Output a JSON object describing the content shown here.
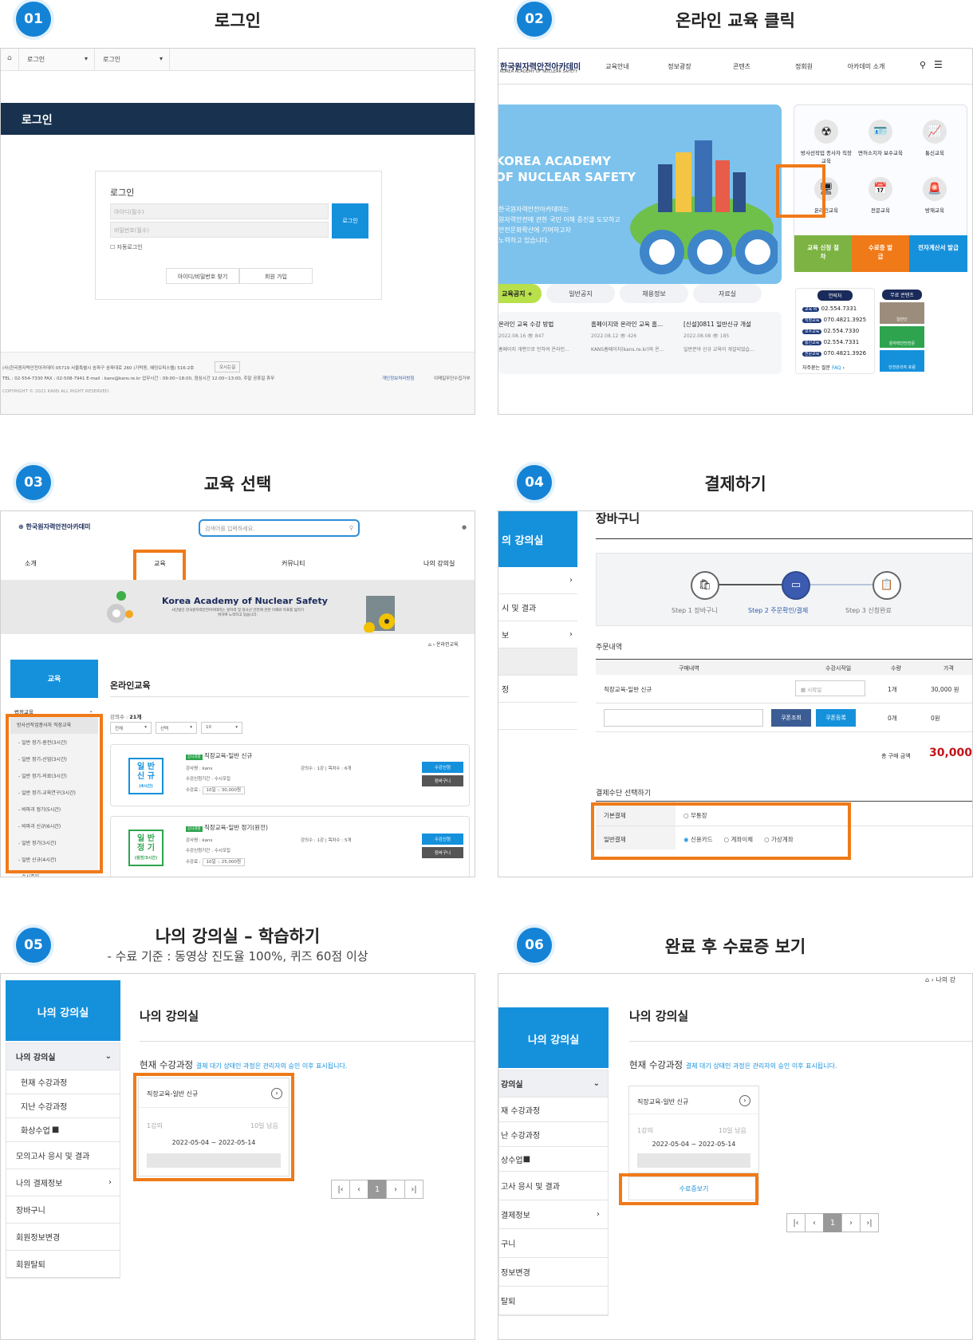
{
  "steps": [
    {
      "num": "01",
      "title": "로그인"
    },
    {
      "num": "02",
      "title": "온라인 교육 클릭"
    },
    {
      "num": "03",
      "title": "교육 선택"
    },
    {
      "num": "04",
      "title": "결제하기"
    },
    {
      "num": "05",
      "title": "나의 강의실 – 학습하기",
      "subtitle": "- 수료 기준 : 동영상 진도율 100%, 퀴즈 60점 이상"
    },
    {
      "num": "06",
      "title": "완료 후 수료증 보기"
    }
  ],
  "p1": {
    "crumb1": "로그인",
    "crumb2": "로그인",
    "banner": "로그인",
    "box_title": "로그인",
    "id_ph": "아이디(필수)",
    "pw_ph": "비밀번호(필수)",
    "login_btn": "로그인",
    "auto": "자동로그인",
    "find": "아이디/비밀번호 찾기",
    "join": "회원 가입",
    "footer1": "(사)한국원자력안전아카데미   05719 서울특별시 송파구 송파대로 260 (가락동, 혜덩오피스텔) 516-2호",
    "footer_btn": "오시는길",
    "footer2": "TEL : 02-554-7330   FAX : 02-508-7941   E-mail : kans@kans.re.kr   업무시간 : 09:00~18:00, 점심시간 12:00~13:00, 주말 공휴일 휴무",
    "privacy": "개인정보처리방침",
    "email_policy": "이메일무단수집거부",
    "copy": "COPYRIGHT © 2021 KANS ALL RIGHT RESERVED."
  },
  "p2": {
    "logo": "한국원자력안전아카데미",
    "logo_sub": "KOREA ACADEMY OF NUCLEAR SAFETY",
    "nav": [
      "교육안내",
      "정보광장",
      "콘텐츠",
      "정회원",
      "아카데미 소개"
    ],
    "hero1": "KOREA ACADEMY",
    "hero2": "OF NUCLEAR SAFETY",
    "hero_desc": [
      "한국원자력안전아카데미는",
      "원자력안전에 관한 국민 이해 증진을 도모하고",
      "안전문화확산에 기여하고자",
      "노력하고 있습니다."
    ],
    "icons": [
      "방사선작업 종사자 직장교육",
      "면허소지자 보수교육",
      "통신교육",
      "온라인교육",
      "전문교육",
      "방재교육"
    ],
    "quick": [
      "교육 신청 절차",
      "수료증 발급",
      "전자계산서 발급"
    ],
    "tabs": [
      "교육공지",
      "일반공지",
      "채용정보",
      "자료실"
    ],
    "notices": [
      {
        "t": "온라인 교육 수강 방법",
        "d": "2022.08.16",
        "v": "847",
        "s": "홈페이지 개편으로 인하여 온라인..."
      },
      {
        "t": "홈페이지와 온라인 교육 홈...",
        "d": "2022.08.12",
        "v": "426",
        "s": "KANS홈페이지(kans.re.kr)와 온..."
      },
      {
        "t": "[신설]0811 일반신규 개설",
        "d": "2022.08.08",
        "v": "185",
        "s": "일반분야 신규 교육이 개설되었습..."
      }
    ],
    "contact_title": "연락처",
    "contacts": [
      {
        "k": "교육 비",
        "v": "02.554.7331"
      },
      {
        "k": "직장교육",
        "v": "070.4821.3925"
      },
      {
        "k": "보수교육",
        "v": "02.554.7330"
      },
      {
        "k": "통신교육",
        "v": "02.554.7331"
      },
      {
        "k": "전문교육",
        "v": "070.4821.3926"
      }
    ],
    "faq": "자주묻는 질문",
    "faq_tag": "FAQ",
    "free_title": "무료 콘텐츠",
    "free": [
      "일반인",
      "원자력안전전문",
      "안전관리자 포럼"
    ]
  },
  "p3": {
    "logo": "한국원자력안전아카데미",
    "search_ph": "검색어를 입력하세요.",
    "menu": [
      "소개",
      "교육",
      "커뮤니티",
      "나의 강의실"
    ],
    "banner_title": "Korea Academy of Nuclear Safety",
    "banner_sub": "사단법인 한국원자력안전아카데미는 원자력 및 방사선 안전에 관한 이해와 목표를 넓히기 위하여 노력하고 있습니다.",
    "crumb": "온라인교육",
    "side_head": "교육",
    "side_cat": "법정교육",
    "side_items": [
      "방사선작업종사자 직장교육",
      "- 일반 정기-원전(3시간)",
      "- 일반 정기-산업(3시간)",
      "- 일반 정기-의료(3시간)",
      "- 일반 정기-교육연구(3시간)",
      "- 비파괴 정기(5시간)",
      "- 비파괴 신규(6시간)",
      "- 일반 정기(3시간)",
      "- 일반 신규(4시간)",
      "- 수시주일"
    ],
    "page_title": "온라인교육",
    "count_label": "강의수 :",
    "count": "21개",
    "filters": [
      "전체",
      "선택",
      "10"
    ],
    "courses": [
      {
        "thumb1": "일 반",
        "thumb2": "신 규",
        "thumb3": "(4시간)",
        "tag": "상시과정",
        "name": "직장교육-일반 신규",
        "teacher": "강사명 :  kans",
        "period": "수강신청기간 :  수시모집",
        "fee_label": "수강료 :",
        "fee": "10일  :: 30,000원",
        "lec": "강의수 :  1강 | 목차수 :  6개",
        "apply": "수강신청",
        "cart": "장바구니"
      },
      {
        "thumb1": "일 반",
        "thumb2": "정 기",
        "thumb3": "(원전/3시간)",
        "tag": "상시과정",
        "name": "직장교육-일반 정기(원전)",
        "teacher": "강사명 :  kans",
        "period": "수강신청기간 :  수시모집",
        "fee_label": "수강료 :",
        "fee": "10일  :: 25,000원",
        "lec": "강의수 :  1강 | 목차수 :  5개",
        "apply": "수강신청",
        "cart": "장바구니"
      }
    ]
  },
  "p4": {
    "side_head": "의 강의실",
    "side": [
      "",
      "시 및 결과",
      "보",
      "",
      "정",
      ""
    ],
    "title": "장바구니",
    "steps": [
      {
        "n": "Step 1",
        "l": "장바구니"
      },
      {
        "n": "Step 2",
        "l": "주문확인/결제"
      },
      {
        "n": "Step 3",
        "l": "신청완료"
      }
    ],
    "order_title": "주문내역",
    "cols": [
      "구매내역",
      "수강시작일",
      "수량",
      "가격"
    ],
    "row": {
      "name": "직장교육-일반 신규",
      "date_ph": "시작일",
      "qty": "1개",
      "price": "30,000 원"
    },
    "coupon_q": "쿠폰조회",
    "coupon_r": "쿠폰등록",
    "coupon_qty": "0개",
    "coupon_price": "0원",
    "total_label": "총 구매 금액",
    "total": "30,000",
    "pay_title": "결제수단 선택하기",
    "basic": "기본결제",
    "basic_opt": "무통장",
    "general": "일반결제",
    "general_opts": [
      "신용카드",
      "계좌이체",
      "가상계좌"
    ]
  },
  "p5": {
    "side_head": "나의 강의실",
    "side": [
      "나의 강의실",
      "현재 수강과정",
      "지난 수강과정",
      "화상수업",
      "모의고사 응시 및 결과",
      "나의 결제정보",
      "장바구니",
      "회원정보변경",
      "회원탈퇴"
    ],
    "title": "나의 강의실",
    "sub": "현재 수강과정",
    "notice": "결제 대기 상태인 과정은 관리자의 승인 이후 표시됩니다.",
    "card": {
      "name": "직장교육-일반 신규",
      "lec": "1강의",
      "left": "10일 남음",
      "range": "2022-05-04 ~ 2022-05-14"
    },
    "page": "1"
  },
  "p6": {
    "crumb": "나의 강",
    "side_head": "나의 강의실",
    "side": [
      "강의실",
      "재 수강과정",
      "난 수강과정",
      "상수업",
      "고사 응시 및 결과",
      "결제정보",
      "구니",
      "정보변경",
      "탈퇴"
    ],
    "title": "나의 강의실",
    "sub": "현재 수강과정",
    "notice": "결제 대기 상태인 과정은 관리자의 승인 이후 표시됩니다.",
    "card": {
      "name": "직장교육-일반 신규",
      "lec": "1강의",
      "left": "10일 남음",
      "range": "2022-05-04 ~ 2022-05-14"
    },
    "cert": "수료증보기",
    "page": "1"
  }
}
